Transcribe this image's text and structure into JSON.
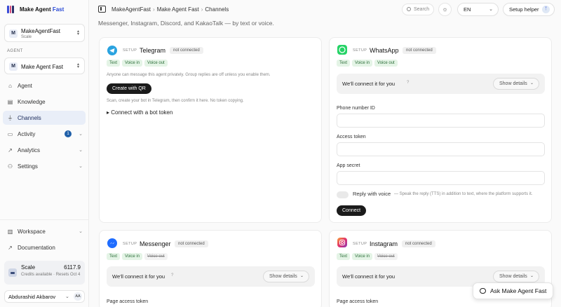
{
  "brand": {
    "name_part1": "Make Agent",
    "name_part2": "Fast",
    "colors": [
      "#3a4cd6",
      "#d64a7a",
      "#2a2f6b"
    ]
  },
  "workspace": {
    "avatar": "M",
    "name": "MakeAgentFast",
    "plan": "Scale"
  },
  "agent_section": {
    "label": "AGENT",
    "avatar": "M",
    "name": "Make Agent Fast"
  },
  "nav": {
    "items": [
      {
        "label": "Agent",
        "icon": "home-icon"
      },
      {
        "label": "Knowledge",
        "icon": "book-icon"
      },
      {
        "label": "Channels",
        "icon": "plug-icon",
        "active": true
      },
      {
        "label": "Activity",
        "icon": "message-icon",
        "badge": "1"
      },
      {
        "label": "Analytics",
        "icon": "chart-icon"
      },
      {
        "label": "Settings",
        "icon": "person-icon"
      }
    ],
    "bottom": [
      {
        "label": "Workspace",
        "icon": "building-icon"
      },
      {
        "label": "Documentation",
        "icon": "external-link-icon"
      }
    ]
  },
  "credits": {
    "title": "Scale",
    "amount": "6117.9",
    "sub": "Credits available · Resets Oct 4"
  },
  "user": {
    "name": "Abdurashid Akbarov",
    "initials": "AA"
  },
  "header": {
    "crumbs": [
      "MakeAgentFast",
      "Make Agent Fast",
      "Channels"
    ],
    "search_label": "Search",
    "language": "EN",
    "setup_helper": "Setup helper"
  },
  "subtitle": "Messenger, Instagram, Discord, and KakaoTalk — by text or voice.",
  "telegram": {
    "setup": "SETUP",
    "name": "Telegram",
    "status": "not connected",
    "tags": [
      "Text",
      "Voice in",
      "Voice out"
    ],
    "desc": "Anyone can message this agent privately. Group replies are off unless you enable them.",
    "create_qr": "Create with QR",
    "qr_hint": "Scan, create your bot in Telegram, then confirm it here. No token copying.",
    "bot_token": "▸ Connect with a bot token"
  },
  "whatsapp": {
    "setup": "SETUP",
    "name": "WhatsApp",
    "status": "not connected",
    "tags": [
      "Text",
      "Voice in",
      "Voice out"
    ],
    "hint": "We'll connect it for you",
    "show_details": "Show details",
    "phone_label": "Phone number ID",
    "token_label": "Access token",
    "secret_label": "App secret",
    "voice_label": "Reply with voice",
    "voice_desc": "— Speak the reply (TTS) in addition to text, where the platform supports it.",
    "connect": "Connect"
  },
  "messenger": {
    "setup": "SETUP",
    "name": "Messenger",
    "status": "not connected",
    "tags": [
      "Text",
      "Voice in"
    ],
    "strike_tag": "Voice out",
    "hint": "We'll connect it for you",
    "show_details": "Show details",
    "token_label": "Page access token"
  },
  "instagram": {
    "setup": "SETUP",
    "name": "Instagram",
    "status": "not connected",
    "tags": [
      "Text",
      "Voice in"
    ],
    "strike_tag": "Voice out",
    "hint": "We'll connect it for you",
    "show_details": "Show details",
    "token_label": "Page access token"
  },
  "ask_button": "Ask Make Agent Fast"
}
